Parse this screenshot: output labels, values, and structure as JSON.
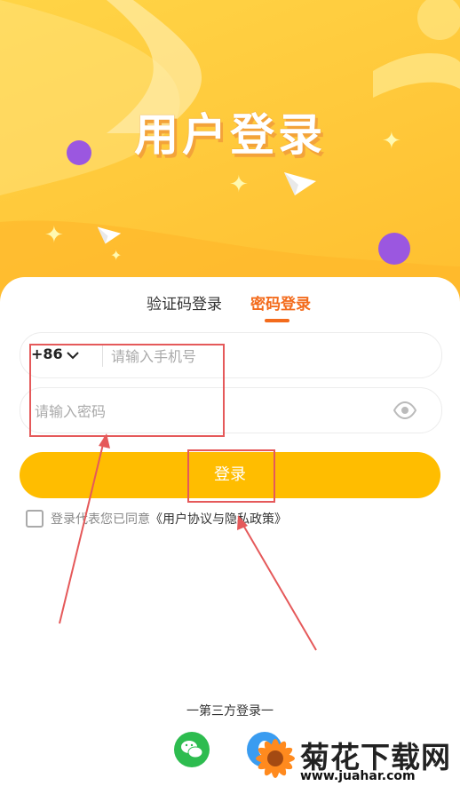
{
  "hero": {
    "title": "用户登录"
  },
  "tabs": [
    {
      "label": "验证码登录",
      "active": false
    },
    {
      "label": "密码登录",
      "active": true
    }
  ],
  "phone": {
    "country_code": "+86",
    "placeholder": "请输入手机号"
  },
  "password": {
    "placeholder": "请输入密码"
  },
  "login_button": {
    "label": "登录"
  },
  "agreement": {
    "prefix": "登录代表您已同意",
    "link": "《用户协议与隐私政策》",
    "checked": false
  },
  "third_party": {
    "title": "一第三方登录一"
  },
  "watermark": {
    "title": "菊花下载网",
    "url": "www.juahar.com"
  },
  "colors": {
    "accent": "#ffbd00",
    "tab_active": "#f36b1c",
    "annotation": "#e5595a",
    "hero": "#ffc83a"
  },
  "icons": [
    "chevron-down-icon",
    "eye-icon",
    "wechat-icon",
    "qq-icon",
    "paper-plane-icon",
    "star-icon"
  ]
}
